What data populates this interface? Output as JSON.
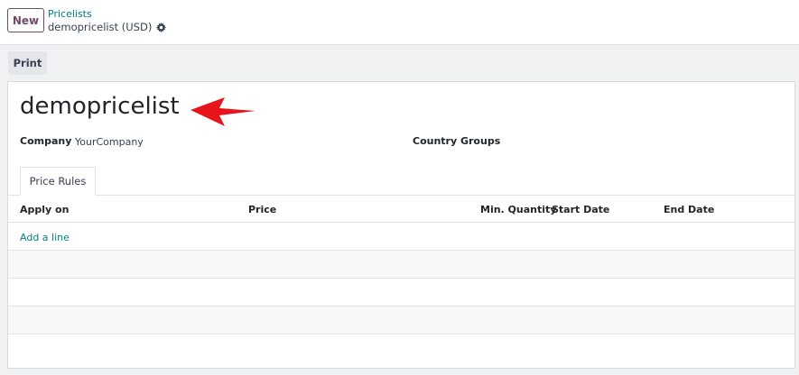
{
  "control_panel": {
    "new_label": "New",
    "breadcrumb": "Pricelists",
    "record_name": "demopricelist (USD)",
    "gear_icon": "gear-icon"
  },
  "toolbar": {
    "print_label": "Print"
  },
  "form": {
    "title": "demopricelist",
    "company_label": "Company",
    "company_value": "YourCompany",
    "country_groups_label": "Country Groups",
    "annotation_icon": "red-arrow-icon"
  },
  "tabs": {
    "price_rules_label": "Price Rules"
  },
  "table": {
    "columns": [
      "Apply on",
      "Price",
      "Min. Quantity",
      "Start Date",
      "End Date"
    ],
    "add_line_label": "Add a line"
  }
}
